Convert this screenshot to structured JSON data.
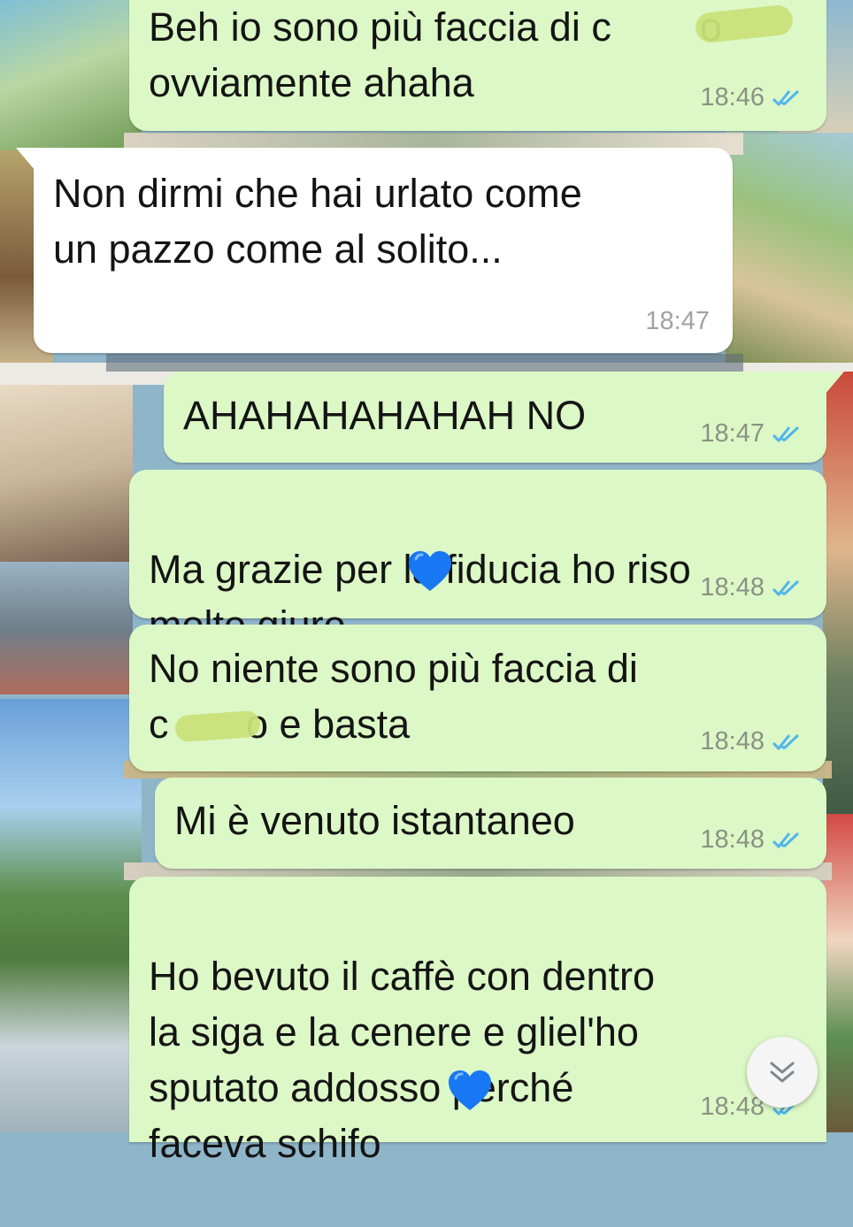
{
  "colors": {
    "outgoing_bubble": "#dcf8c6",
    "incoming_bubble": "#ffffff",
    "read_ticks": "#4fb6ec",
    "heart": "#1877f2"
  },
  "icons": {
    "read_receipt": "double-check-icon",
    "heart": "blue-heart-icon",
    "scroll_down": "chevron-down-icon"
  },
  "messages": [
    {
      "direction": "out",
      "text": "Beh io sono più faccia di c        o\novviamente ahaha",
      "time": "18:46",
      "read": true
    },
    {
      "direction": "in",
      "text": "Non dirmi che hai urlato come\nun pazzo come al solito...",
      "time": "18:47"
    },
    {
      "direction": "out",
      "text": "AHAHAHAHAHAH NO",
      "time": "18:47",
      "read": true
    },
    {
      "direction": "out",
      "text": "Ma grazie per la fiducia ho riso\nmolto giuro",
      "emoji": "💙",
      "time": "18:48",
      "read": true
    },
    {
      "direction": "out",
      "text": "No niente sono più faccia di\nc       o e basta",
      "time": "18:48",
      "read": true
    },
    {
      "direction": "out",
      "text": "Mi è venuto istantaneo",
      "time": "18:48",
      "read": true
    },
    {
      "direction": "out",
      "text": "Ho bevuto il caffè con dentro\nla siga e la cenere e gliel'ho\nsputato addosso perché\nfaceva schifo",
      "emoji": "💙",
      "time": "18:48",
      "read": true
    }
  ]
}
